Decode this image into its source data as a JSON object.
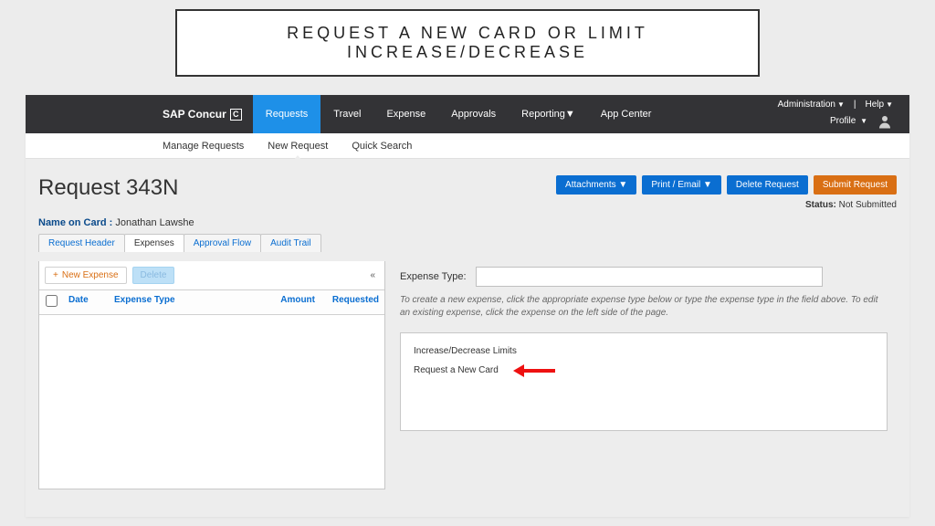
{
  "slide_title": "REQUEST A NEW CARD OR LIMIT INCREASE/DECREASE",
  "brand": {
    "name": "SAP Concur",
    "logo_letter": "C"
  },
  "top_nav": {
    "items": [
      "Requests",
      "Travel",
      "Expense",
      "Approvals",
      "Reporting",
      "App Center"
    ],
    "active_index": 0
  },
  "right_menus": {
    "administration": "Administration",
    "help": "Help",
    "profile": "Profile"
  },
  "sub_nav": {
    "items": [
      "Manage Requests",
      "New Request",
      "Quick Search"
    ],
    "active_index": 1
  },
  "page": {
    "title": "Request 343N",
    "status_label": "Status:",
    "status_value": "Not Submitted"
  },
  "action_buttons": {
    "attachments": "Attachments",
    "print_email": "Print / Email",
    "delete_request": "Delete Request",
    "submit_request": "Submit Request"
  },
  "name_on_card": {
    "label": "Name on Card :",
    "value": "Jonathan Lawshe"
  },
  "tabs": {
    "items": [
      "Request Header",
      "Expenses",
      "Approval Flow",
      "Audit Trail"
    ],
    "active_index": 1
  },
  "left_toolbar": {
    "new_expense": "New Expense",
    "delete": "Delete"
  },
  "grid_headers": {
    "date": "Date",
    "expense_type": "Expense Type",
    "amount": "Amount",
    "requested": "Requested"
  },
  "right_panel": {
    "expense_type_label": "Expense Type:",
    "instruction": "To create a new expense, click the appropriate expense type below or type the expense type in the field above. To edit an existing expense, click the expense on the left side of the page.",
    "options_heading": "Increase/Decrease Limits",
    "option_request_new_card": "Request a New Card"
  }
}
